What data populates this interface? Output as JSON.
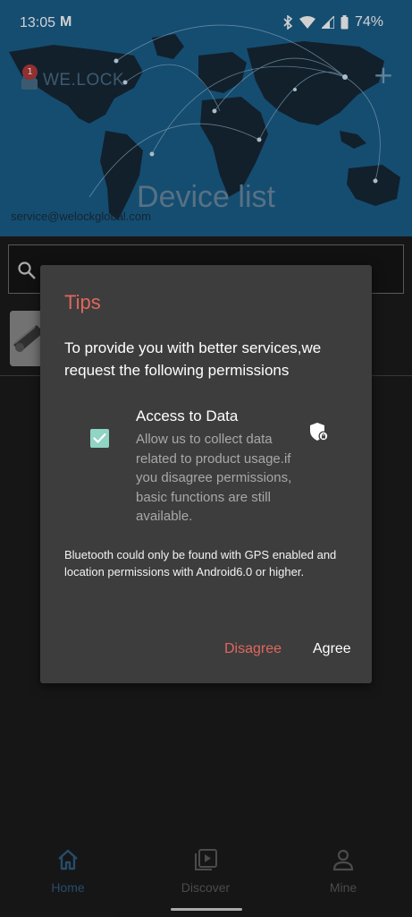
{
  "status_bar": {
    "time": "13:05",
    "notification_icon": "M",
    "battery_percent": "74%"
  },
  "header": {
    "logo_text": "WE.LOCK",
    "badge_count": "1",
    "title": "Device list",
    "service_email": "service@welockglobal.com",
    "add_icon": "+"
  },
  "search": {
    "placeholder": ""
  },
  "dialog": {
    "title": "Tips",
    "message": "To provide you with better services,we request the following permissions",
    "permission": {
      "title": "Access to Data",
      "description": "Allow us to collect data related to product usage.if you disagree permissions, basic functions are still available.",
      "checked": true
    },
    "note": "Bluetooth could only be found with GPS enabled and location permissions with Android6.0 or higher.",
    "disagree_label": "Disagree",
    "agree_label": "Agree"
  },
  "bottom_nav": {
    "items": [
      {
        "label": "Home",
        "icon": "home-icon",
        "active": true
      },
      {
        "label": "Discover",
        "icon": "discover-icon",
        "active": false
      },
      {
        "label": "Mine",
        "icon": "person-icon",
        "active": false
      }
    ]
  },
  "colors": {
    "header_blue": "#1a5e8a",
    "accent_red": "#e0665e",
    "check_teal": "#8fd4c4",
    "nav_active": "#2f5d82"
  }
}
